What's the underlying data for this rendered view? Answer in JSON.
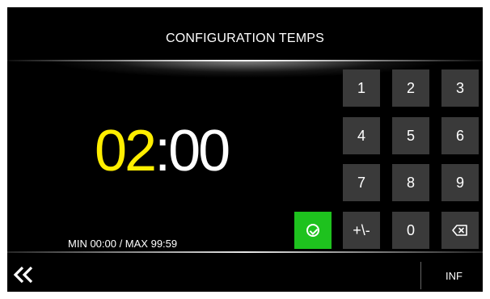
{
  "screen": {
    "title": "CONFIGURATION TEMPS",
    "time": {
      "minutes": "02",
      "separator": ":",
      "seconds": "00"
    },
    "range_text": "MIN 00:00 / MAX 99:59"
  },
  "keypad": {
    "keys": [
      "1",
      "2",
      "3",
      "4",
      "5",
      "6",
      "7",
      "8",
      "9",
      "+\\-",
      "0"
    ],
    "backspace_icon": "backspace-icon",
    "confirm_icon": "check-circle-icon"
  },
  "footer": {
    "back_icon": "double-chevron-left-icon",
    "inf_label": "INF"
  },
  "colors": {
    "background": "#000000",
    "minutes": "#ffee00",
    "key": "#3a3a3a",
    "confirm": "#1ec21e"
  }
}
